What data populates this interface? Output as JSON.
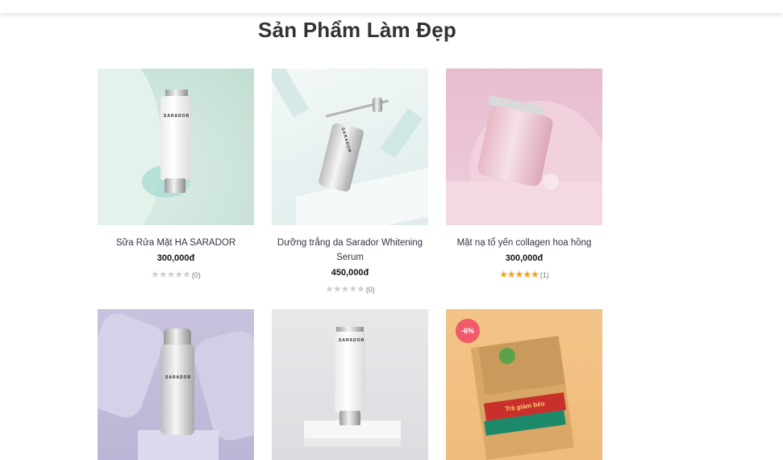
{
  "section": {
    "title": "Sản Phẩm Làm Đẹp"
  },
  "colors": {
    "star_on": "#f0a11b",
    "star_off": "#cfcfcf",
    "badge": "#f05a6b"
  },
  "products": [
    {
      "name": "Sữa Rửa Mặt HA SARADOR",
      "price": "300,000đ",
      "rating": 0,
      "reviews": "(0)",
      "brand_label": "SARADOR"
    },
    {
      "name": "Dưỡng trắng da Sarador Whitening Serum",
      "price": "450,000đ",
      "rating": 0,
      "reviews": "(0)",
      "brand_label": "SARADOR"
    },
    {
      "name": "Mặt nạ tổ yến collagen hoa hồng",
      "price": "300,000đ",
      "rating": 5,
      "reviews": "(1)"
    },
    {
      "brand_label": "SARADOR"
    },
    {
      "brand_label": "SARADOR"
    },
    {
      "badge": "-6%",
      "box_label": "Trà giảm béo"
    }
  ]
}
